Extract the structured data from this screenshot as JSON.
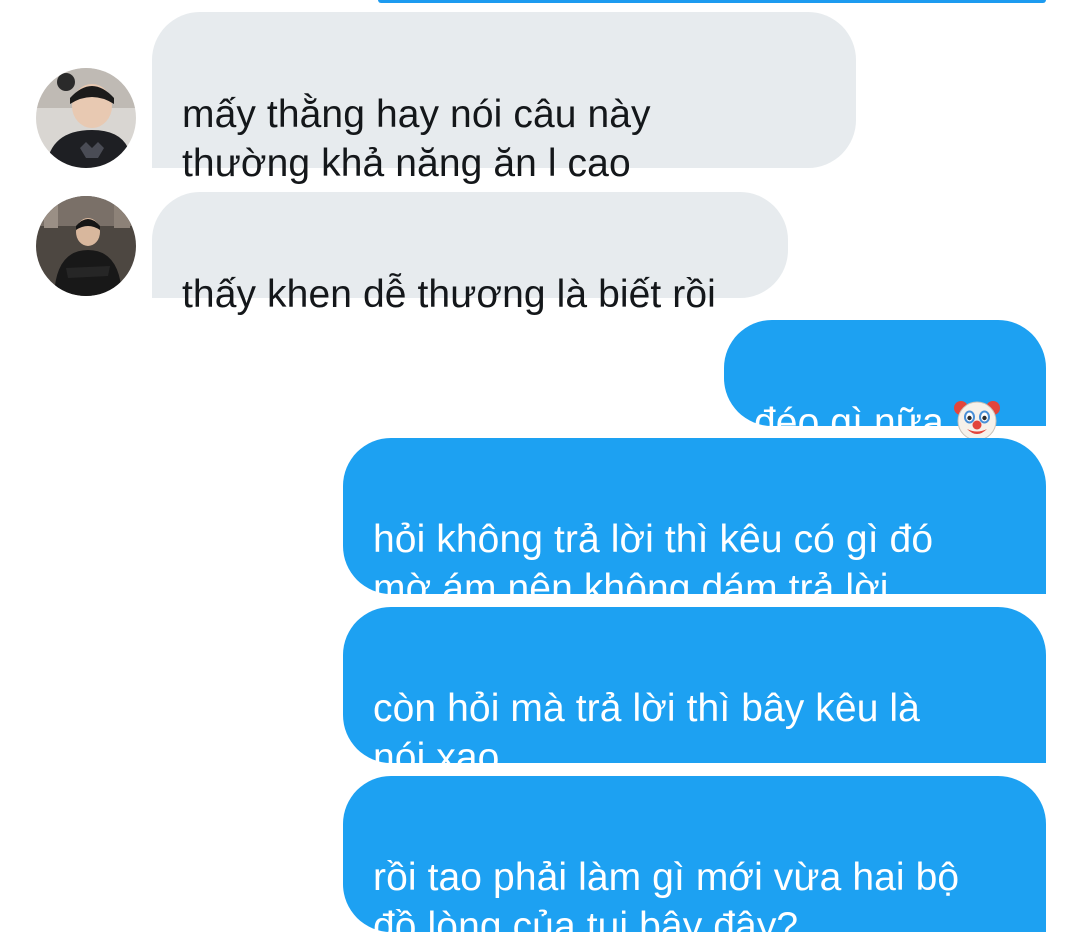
{
  "conversation": {
    "messages": [
      {
        "direction": "incoming",
        "avatar": "avatar-user-1",
        "text": "mấy thằng hay nói câu này\nthường khả năng ăn l cao"
      },
      {
        "direction": "incoming",
        "avatar": "avatar-user-2",
        "text": "thấy khen dễ thương là biết rồi"
      },
      {
        "direction": "outgoing",
        "text": "đéo gì nữa",
        "emoji": "clown-face-icon"
      },
      {
        "direction": "outgoing",
        "text": "hỏi không trả lời thì kêu có gì đó\nmờ ám nên không dám trả lời"
      },
      {
        "direction": "outgoing",
        "text": "còn hỏi mà trả lời thì bây kêu là\nnói xạo"
      },
      {
        "direction": "outgoing",
        "text": "rồi tao phải làm gì mới vừa hai bộ\nđồ lòng của tụi bây đây?"
      }
    ]
  },
  "colors": {
    "incoming_bubble": "#e7ebee",
    "incoming_text": "#14171a",
    "outgoing_bubble": "#1da1f2",
    "outgoing_text": "#ffffff"
  }
}
